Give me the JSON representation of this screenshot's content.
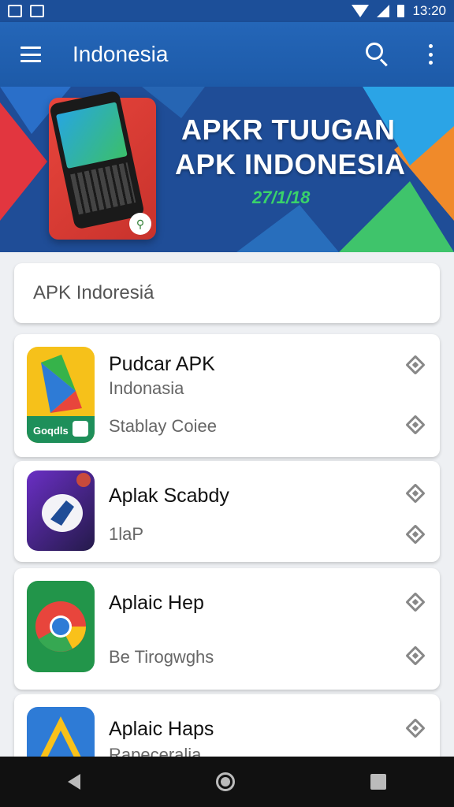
{
  "status_bar": {
    "time": "13:20"
  },
  "app_bar": {
    "title": "Indonesia"
  },
  "banner": {
    "line1": "APKR TUUGAN",
    "line2": "APK INDONESIA",
    "date": "27/1/18"
  },
  "search": {
    "text": "APK Indoresiá"
  },
  "apps": [
    {
      "name": "Pudcar APK",
      "sub1": "Indonasia",
      "sub2": "Stablay Coiee",
      "icon_label": "Goqdls"
    },
    {
      "name": "Aplak Scabdy",
      "sub1": "1laP"
    },
    {
      "name": "Aplaic Hep",
      "sub1": "Be Tirogwghs"
    },
    {
      "name": "Aplaic Haps",
      "sub1": "Rapeceralia"
    }
  ]
}
